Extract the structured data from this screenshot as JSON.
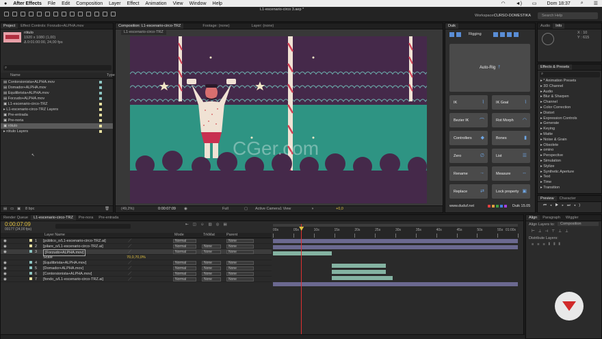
{
  "menubar": {
    "app": "After Effects",
    "items": [
      "File",
      "Edit",
      "Composition",
      "Layer",
      "Effect",
      "Animation",
      "View",
      "Window",
      "Help"
    ],
    "clock": "Dom 18:37"
  },
  "window": {
    "title": "L1-escenario-circo 3.aep *"
  },
  "toolbar": {
    "workspace_label": "Workspace:",
    "workspace_value": "CURSO-DOMESTIKA",
    "search_placeholder": "Search Help"
  },
  "project": {
    "tabs": [
      "Project",
      "Effect Controls: Forzudo+ALPHA.mov"
    ],
    "selected_name": "rótulo",
    "selected_size": "1920 x 1080 (1,00)",
    "selected_duration": "Δ 0:01:00:00, 24,00 fps",
    "search_placeholder": "",
    "columns": {
      "name": "Name",
      "type": "Type"
    },
    "items": [
      {
        "name": "Contorsionista+ALPHA.mov",
        "color": "#8dc6c3"
      },
      {
        "name": "Domador+ALPHA.mov",
        "color": "#8dc6c3"
      },
      {
        "name": "Equilibrista+ALPHA.mov",
        "color": "#8dc6c3"
      },
      {
        "name": "Forzudo+ALPHA.mov",
        "color": "#8dc6c3"
      },
      {
        "name": "L1-escenario-circo-TRZ",
        "color": "#e7e0a0"
      },
      {
        "name": "L1-escenario-circo-TRZ Layers",
        "color": "#e7e0a0"
      },
      {
        "name": "Pre-entrada",
        "color": "#e7e0a0"
      },
      {
        "name": "Pre-noria",
        "color": "#e7e0a0"
      },
      {
        "name": "rótulo",
        "color": "#e7e0a0"
      },
      {
        "name": "rótulo Layers",
        "color": "#e7e0a0"
      }
    ],
    "bpc": "8 bpc"
  },
  "composition": {
    "tabs": [
      "Composition: L1-escenario-circo-TRZ",
      "Footage: (none)",
      "Layer: (none)"
    ],
    "crumb": "L1-escenario-circo-TRZ",
    "footer": {
      "zoom": "(49,2%)",
      "timecode": "0:00:07:09",
      "resolution": "Full",
      "camera": "Active Camera",
      "views": "1 View",
      "exposure": "+0,0"
    },
    "watermark": "CGer.com"
  },
  "duik": {
    "tab": "Duik",
    "rigging": "Rigging",
    "autorig": "Auto-Rig",
    "buttons": [
      "IK",
      "IK Goal",
      "Bezier IK",
      "Rot Morph",
      "Controllers",
      "Bones",
      "Zero",
      "List",
      "Rename",
      "Measure",
      "Replace",
      "Lock property"
    ],
    "site": "www.duduf.net",
    "version": "Duik 15.05"
  },
  "info": {
    "tabs": [
      "Audio",
      "Info"
    ],
    "x": "X : 10",
    "y": "Y : 615"
  },
  "effects": {
    "tab": "Effects & Presets",
    "items": [
      "* Animation Presets",
      "3D Channel",
      "Audio",
      "Blur & Sharpen",
      "Channel",
      "Color Correction",
      "Distort",
      "Expression Controls",
      "Generate",
      "Keying",
      "Matte",
      "Noise & Grain",
      "Obsolete",
      "omino",
      "Perspective",
      "Simulation",
      "Stylize",
      "Synthetic Aperture",
      "Text",
      "Time",
      "Transition"
    ]
  },
  "preview": {
    "tabs": [
      "Preview",
      "Character"
    ]
  },
  "timeline": {
    "tabs": [
      "Render Queue",
      "L1-escenario-circo-TRZ",
      "Pre-nora",
      "Pre-entrada"
    ],
    "timecode": "0:00:07:09",
    "frames": "00177 (24,00 fps)",
    "columns": {
      "layer_name": "Layer Name",
      "mode": "Mode",
      "trkmat": "TrkMat",
      "parent": "Parent"
    },
    "ruler": [
      "00s",
      "05s",
      "10s",
      "15s",
      "20s",
      "25s",
      "30s",
      "35s",
      "40s",
      "45s",
      "50s",
      "55s",
      "01:00s"
    ],
    "playhead_pct": 0.115,
    "layers": [
      {
        "num": "1",
        "name": "[público_o/L1-escenario-circo-TRZ.ai]",
        "mode": "Normal",
        "trkmat": "",
        "parent": "None",
        "color": "#e7e0a0",
        "bar_start": 0.0,
        "bar_end": 1.0,
        "bar_color": "#6b6990"
      },
      {
        "num": "2",
        "name": "[pilare_o/L1-escenario-circo-TRZ.ai]",
        "mode": "Normal",
        "trkmat": "None",
        "parent": "None",
        "color": "#e7e0a0",
        "bar_start": 0.0,
        "bar_end": 1.0,
        "bar_color": "#6b6990"
      },
      {
        "num": "3",
        "name": "[Forzudo+ALPHA.mov]",
        "mode": "Normal",
        "trkmat": "None",
        "parent": "None",
        "color": "#8dc6c3",
        "bar_start": 0.0,
        "bar_end": 0.24,
        "bar_color": "#84b3a2",
        "selected": true
      },
      {
        "num": "",
        "name": "Scale",
        "mode": "70,0,70,0%",
        "trkmat": "",
        "parent": "",
        "color": "",
        "bar_start": 0,
        "bar_end": 0,
        "bar_color": "",
        "sub": true
      },
      {
        "num": "4",
        "name": "[Equilibrista+ALPHA.mov]",
        "mode": "Normal",
        "trkmat": "None",
        "parent": "None",
        "color": "#8dc6c3",
        "bar_start": 0.24,
        "bar_end": 0.46,
        "bar_color": "#84b3a2"
      },
      {
        "num": "5",
        "name": "[Domador+ALPHA.mov]",
        "mode": "Normal",
        "trkmat": "None",
        "parent": "None",
        "color": "#8dc6c3",
        "bar_start": 0.24,
        "bar_end": 0.46,
        "bar_color": "#84b3a2"
      },
      {
        "num": "6",
        "name": "[Contorsionista+ALPHA.mov]",
        "mode": "Normal",
        "trkmat": "None",
        "parent": "None",
        "color": "#8dc6c3",
        "bar_start": 0.24,
        "bar_end": 0.49,
        "bar_color": "#84b3a2"
      },
      {
        "num": "7",
        "name": "[fondo_o/L1-escenario-circo-TRZ.ai]",
        "mode": "Normal",
        "trkmat": "None",
        "parent": "None",
        "color": "#e7e0a0",
        "bar_start": 0.0,
        "bar_end": 1.0,
        "bar_color": "#6b6990"
      }
    ]
  },
  "align": {
    "tabs": [
      "Align",
      "Paragraph",
      "Wiggler"
    ],
    "align_to_label": "Align Layers to:",
    "align_to_value": "Composition",
    "distribute_label": "Distribute Layers:"
  }
}
